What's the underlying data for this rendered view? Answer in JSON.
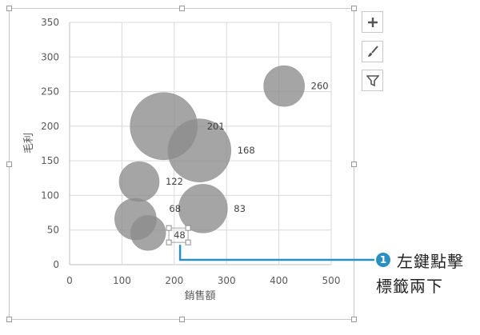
{
  "chart_data": {
    "type": "bubble",
    "xlabel": "銷售額",
    "ylabel": "毛利",
    "xlim": [
      0,
      500
    ],
    "ylim": [
      0,
      350
    ],
    "x_ticks": [
      "0",
      "100",
      "200",
      "300",
      "400",
      "500"
    ],
    "y_ticks": [
      "0",
      "50",
      "100",
      "150",
      "200",
      "250",
      "300",
      "350"
    ],
    "grid": true,
    "bubble_color": "#8c8c8c",
    "points": [
      {
        "x": 180,
        "y": 200,
        "size": 84,
        "label": "201"
      },
      {
        "x": 248,
        "y": 165,
        "size": 79,
        "label": "168"
      },
      {
        "x": 410,
        "y": 258,
        "size": 51,
        "label": "260"
      },
      {
        "x": 133,
        "y": 120,
        "size": 50,
        "label": "122"
      },
      {
        "x": 255,
        "y": 81,
        "size": 61,
        "label": "83"
      },
      {
        "x": 126,
        "y": 66,
        "size": 52,
        "label": "68"
      },
      {
        "x": 150,
        "y": 46,
        "size": 44,
        "label": "48"
      }
    ]
  },
  "side_buttons": [
    {
      "icon": "plus-icon"
    },
    {
      "icon": "brush-icon"
    },
    {
      "icon": "filter-icon"
    }
  ],
  "callout": {
    "number": "1",
    "line1": "左鍵點擊",
    "line2": "標籤兩下",
    "color": "#2a8fc1"
  }
}
